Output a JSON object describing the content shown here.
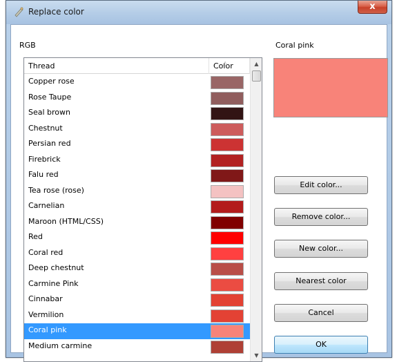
{
  "window": {
    "title": "Replace color",
    "close_label": "x"
  },
  "rgb_group_label": "RGB",
  "table": {
    "columns": [
      "Thread",
      "Color"
    ],
    "rows": [
      {
        "name": "Copper rose",
        "color": "#996666"
      },
      {
        "name": "Rose Taupe",
        "color": "#905d5d"
      },
      {
        "name": "Seal brown",
        "color": "#321414"
      },
      {
        "name": "Chestnut",
        "color": "#cd5c5c"
      },
      {
        "name": "Persian red",
        "color": "#cc3333"
      },
      {
        "name": "Firebrick",
        "color": "#b22222"
      },
      {
        "name": "Falu red",
        "color": "#801818"
      },
      {
        "name": "Tea rose (rose)",
        "color": "#f4c2c2"
      },
      {
        "name": "Carnelian",
        "color": "#b31b1b"
      },
      {
        "name": "Maroon (HTML/CSS)",
        "color": "#800000"
      },
      {
        "name": "Red",
        "color": "#ff0000"
      },
      {
        "name": "Coral red",
        "color": "#ff4040"
      },
      {
        "name": "Deep chestnut",
        "color": "#b94e48"
      },
      {
        "name": "Carmine Pink",
        "color": "#eb4c42"
      },
      {
        "name": "Cinnabar",
        "color": "#e34234"
      },
      {
        "name": "Vermilion",
        "color": "#e34234"
      },
      {
        "name": "Coral pink",
        "color": "#f88379",
        "selected": true
      },
      {
        "name": "Medium carmine",
        "color": "#af4035"
      }
    ]
  },
  "preview": {
    "label": "Coral pink",
    "color": "#f88379"
  },
  "buttons": {
    "edit": "Edit color...",
    "remove": "Remove color...",
    "new": "New color...",
    "nearest": "Nearest color",
    "cancel": "Cancel",
    "ok": "OK"
  },
  "icons": {
    "title": "palette-icon",
    "sort": "sort-up-icon",
    "scroll_up": "scroll-up-icon",
    "scroll_down": "scroll-down-icon"
  }
}
